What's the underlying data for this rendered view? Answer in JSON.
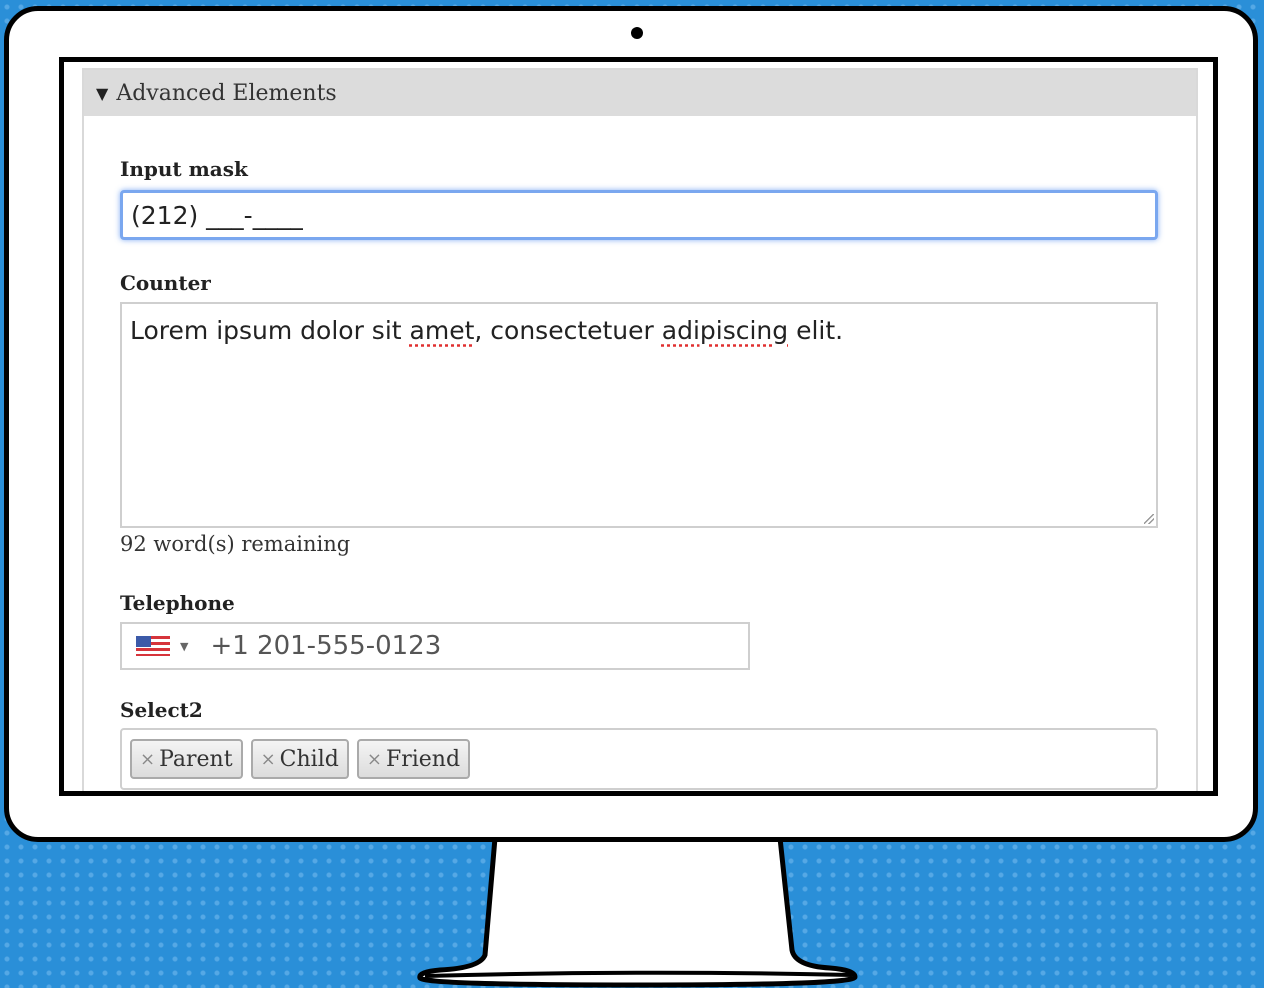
{
  "panel": {
    "title": "Advanced Elements",
    "toggle_icon": "triangle-down-icon"
  },
  "fields": {
    "input_mask": {
      "label": "Input mask",
      "value": "(212) ___-____"
    },
    "counter": {
      "label": "Counter",
      "text_before_1": "Lorem ipsum dolor sit ",
      "misspelled_1": "amet",
      "text_between": ", consectetuer ",
      "misspelled_2": "adipiscing",
      "text_after": " elit.",
      "remaining": "92 word(s) remaining"
    },
    "telephone": {
      "label": "Telephone",
      "country_icon": "us-flag-icon",
      "placeholder": "+1 201-555-0123"
    },
    "select2": {
      "label": "Select2",
      "remove_glyph": "×",
      "tags": [
        "Parent",
        "Child",
        "Friend"
      ]
    }
  },
  "colors": {
    "background": "#2a8fd8",
    "focus_border": "#7aa7ef",
    "panel_header": "#dcdcdc"
  }
}
